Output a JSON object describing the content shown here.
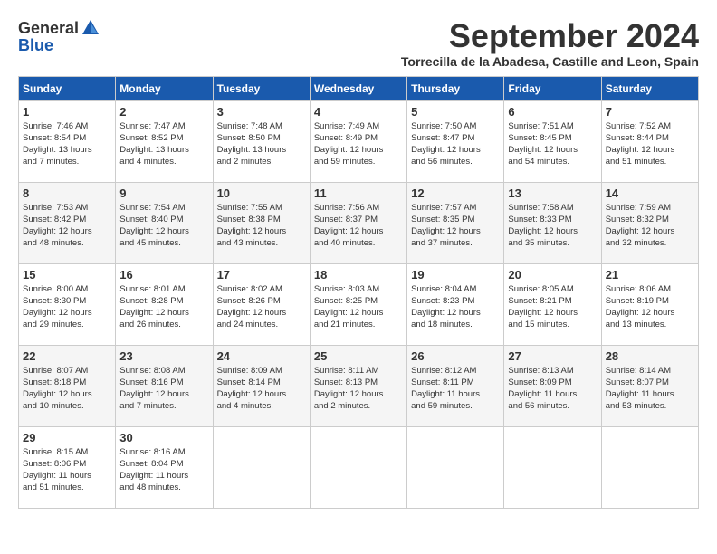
{
  "header": {
    "logo_general": "General",
    "logo_blue": "Blue",
    "month_title": "September 2024",
    "location": "Torrecilla de la Abadesa, Castille and Leon, Spain"
  },
  "weekdays": [
    "Sunday",
    "Monday",
    "Tuesday",
    "Wednesday",
    "Thursday",
    "Friday",
    "Saturday"
  ],
  "weeks": [
    [
      {
        "day": "1",
        "info": "Sunrise: 7:46 AM\nSunset: 8:54 PM\nDaylight: 13 hours\nand 7 minutes."
      },
      {
        "day": "2",
        "info": "Sunrise: 7:47 AM\nSunset: 8:52 PM\nDaylight: 13 hours\nand 4 minutes."
      },
      {
        "day": "3",
        "info": "Sunrise: 7:48 AM\nSunset: 8:50 PM\nDaylight: 13 hours\nand 2 minutes."
      },
      {
        "day": "4",
        "info": "Sunrise: 7:49 AM\nSunset: 8:49 PM\nDaylight: 12 hours\nand 59 minutes."
      },
      {
        "day": "5",
        "info": "Sunrise: 7:50 AM\nSunset: 8:47 PM\nDaylight: 12 hours\nand 56 minutes."
      },
      {
        "day": "6",
        "info": "Sunrise: 7:51 AM\nSunset: 8:45 PM\nDaylight: 12 hours\nand 54 minutes."
      },
      {
        "day": "7",
        "info": "Sunrise: 7:52 AM\nSunset: 8:44 PM\nDaylight: 12 hours\nand 51 minutes."
      }
    ],
    [
      {
        "day": "8",
        "info": "Sunrise: 7:53 AM\nSunset: 8:42 PM\nDaylight: 12 hours\nand 48 minutes."
      },
      {
        "day": "9",
        "info": "Sunrise: 7:54 AM\nSunset: 8:40 PM\nDaylight: 12 hours\nand 45 minutes."
      },
      {
        "day": "10",
        "info": "Sunrise: 7:55 AM\nSunset: 8:38 PM\nDaylight: 12 hours\nand 43 minutes."
      },
      {
        "day": "11",
        "info": "Sunrise: 7:56 AM\nSunset: 8:37 PM\nDaylight: 12 hours\nand 40 minutes."
      },
      {
        "day": "12",
        "info": "Sunrise: 7:57 AM\nSunset: 8:35 PM\nDaylight: 12 hours\nand 37 minutes."
      },
      {
        "day": "13",
        "info": "Sunrise: 7:58 AM\nSunset: 8:33 PM\nDaylight: 12 hours\nand 35 minutes."
      },
      {
        "day": "14",
        "info": "Sunrise: 7:59 AM\nSunset: 8:32 PM\nDaylight: 12 hours\nand 32 minutes."
      }
    ],
    [
      {
        "day": "15",
        "info": "Sunrise: 8:00 AM\nSunset: 8:30 PM\nDaylight: 12 hours\nand 29 minutes."
      },
      {
        "day": "16",
        "info": "Sunrise: 8:01 AM\nSunset: 8:28 PM\nDaylight: 12 hours\nand 26 minutes."
      },
      {
        "day": "17",
        "info": "Sunrise: 8:02 AM\nSunset: 8:26 PM\nDaylight: 12 hours\nand 24 minutes."
      },
      {
        "day": "18",
        "info": "Sunrise: 8:03 AM\nSunset: 8:25 PM\nDaylight: 12 hours\nand 21 minutes."
      },
      {
        "day": "19",
        "info": "Sunrise: 8:04 AM\nSunset: 8:23 PM\nDaylight: 12 hours\nand 18 minutes."
      },
      {
        "day": "20",
        "info": "Sunrise: 8:05 AM\nSunset: 8:21 PM\nDaylight: 12 hours\nand 15 minutes."
      },
      {
        "day": "21",
        "info": "Sunrise: 8:06 AM\nSunset: 8:19 PM\nDaylight: 12 hours\nand 13 minutes."
      }
    ],
    [
      {
        "day": "22",
        "info": "Sunrise: 8:07 AM\nSunset: 8:18 PM\nDaylight: 12 hours\nand 10 minutes."
      },
      {
        "day": "23",
        "info": "Sunrise: 8:08 AM\nSunset: 8:16 PM\nDaylight: 12 hours\nand 7 minutes."
      },
      {
        "day": "24",
        "info": "Sunrise: 8:09 AM\nSunset: 8:14 PM\nDaylight: 12 hours\nand 4 minutes."
      },
      {
        "day": "25",
        "info": "Sunrise: 8:11 AM\nSunset: 8:13 PM\nDaylight: 12 hours\nand 2 minutes."
      },
      {
        "day": "26",
        "info": "Sunrise: 8:12 AM\nSunset: 8:11 PM\nDaylight: 11 hours\nand 59 minutes."
      },
      {
        "day": "27",
        "info": "Sunrise: 8:13 AM\nSunset: 8:09 PM\nDaylight: 11 hours\nand 56 minutes."
      },
      {
        "day": "28",
        "info": "Sunrise: 8:14 AM\nSunset: 8:07 PM\nDaylight: 11 hours\nand 53 minutes."
      }
    ],
    [
      {
        "day": "29",
        "info": "Sunrise: 8:15 AM\nSunset: 8:06 PM\nDaylight: 11 hours\nand 51 minutes."
      },
      {
        "day": "30",
        "info": "Sunrise: 8:16 AM\nSunset: 8:04 PM\nDaylight: 11 hours\nand 48 minutes."
      },
      null,
      null,
      null,
      null,
      null
    ]
  ]
}
